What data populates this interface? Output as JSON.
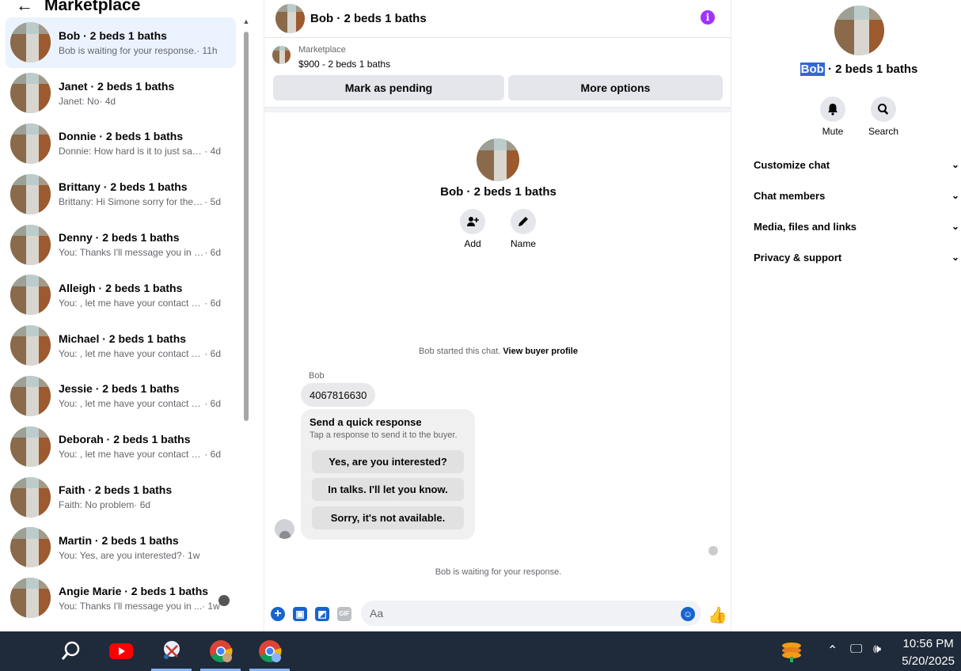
{
  "left": {
    "title": "Marketplace",
    "conversations": [
      {
        "name": "Bob · 2 beds 1 baths",
        "snippet": "Bob is waiting for your response.",
        "time": "· 11h"
      },
      {
        "name": "Janet · 2 beds 1 baths",
        "snippet": "Janet: No",
        "time": "· 4d"
      },
      {
        "name": "Donnie · 2 beds 1 baths",
        "snippet": "Donnie: How hard is it to just say y...",
        "time": "· 4d"
      },
      {
        "name": "Brittany · 2 beds 1 baths",
        "snippet": "Brittany: Hi Simone sorry for the lat...",
        "time": "· 5d"
      },
      {
        "name": "Denny · 2 beds 1 baths",
        "snippet": "You: Thanks I'll message you in a ...",
        "time": "· 6d"
      },
      {
        "name": "Alleigh · 2 beds 1 baths",
        "snippet": "You: , let me have your contact nu...",
        "time": "· 6d"
      },
      {
        "name": "Michael · 2 beds 1 baths",
        "snippet": "You: , let me have your contact nu...",
        "time": "· 6d"
      },
      {
        "name": "Jessie · 2 beds 1 baths",
        "snippet": "You: , let me have your contact nu...",
        "time": "· 6d"
      },
      {
        "name": "Deborah · 2 beds 1 baths",
        "snippet": "You: , let me have your contact nu...",
        "time": "· 6d"
      },
      {
        "name": "Faith · 2 beds 1 baths",
        "snippet": "Faith: No problem",
        "time": "· 6d"
      },
      {
        "name": "Martin · 2 beds 1 baths",
        "snippet": "You: Yes, are you interested?",
        "time": "· 1w"
      },
      {
        "name": "Angie Marie · 2 beds 1 baths",
        "snippet": "You: Thanks I'll message you in ...",
        "time": "· 1w"
      }
    ]
  },
  "chat": {
    "title": "Bob · 2 beds 1 baths",
    "listing_label": "Marketplace",
    "listing_price": "$900 - 2 beds 1 baths",
    "pending_button": "Mark as pending",
    "more_button": "More options",
    "profile_name": "Bob · 2 beds 1 baths",
    "add_label": "Add",
    "name_label": "Name",
    "started_text": "Bob started this chat.",
    "view_profile": "View buyer profile",
    "sender": "Bob",
    "phone_message": "4067816630",
    "quick_title": "Send a quick response",
    "quick_sub": "Tap a response to send it to the buyer.",
    "quick_responses": [
      "Yes, are you interested?",
      "In talks. I'll let you know.",
      "Sorry, it's not available."
    ],
    "waiting_text": "Bob is waiting for your response.",
    "input_placeholder": "Aa",
    "gif_label": "GIF"
  },
  "right": {
    "name_highlight": "Bob",
    "name_rest": " · 2 beds 1 baths",
    "mute_label": "Mute",
    "search_label": "Search",
    "sections": [
      "Customize chat",
      "Chat members",
      "Media, files and links",
      "Privacy & support"
    ]
  },
  "taskbar": {
    "time": "10:56 PM",
    "date": "5/20/2025"
  },
  "colors": {
    "accent": "#1763cf",
    "active_row": "#ebf3fe",
    "info": "#a033ff",
    "taskbar": "#1f2a3a"
  }
}
